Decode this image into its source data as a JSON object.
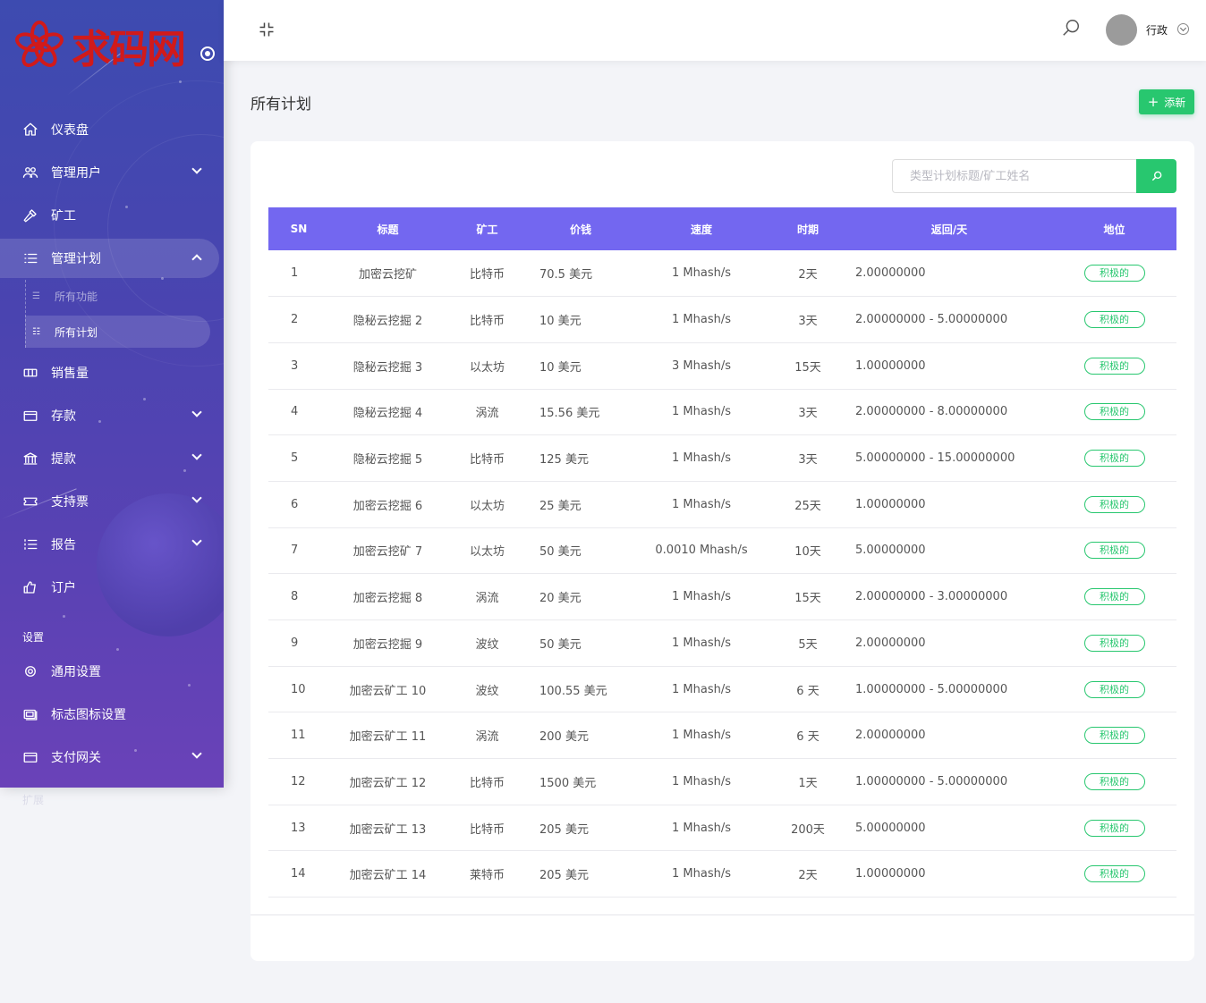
{
  "brand": {
    "logo_text": "求码网"
  },
  "sidebar": {
    "items": [
      {
        "label": "仪表盘",
        "icon": "home-icon"
      },
      {
        "label": "管理用户",
        "icon": "users-icon"
      },
      {
        "label": "矿工",
        "icon": "hammer-icon"
      },
      {
        "label": "管理计划",
        "icon": "list-icon"
      },
      {
        "label": "销售量",
        "icon": "ticket-icon"
      },
      {
        "label": "存款",
        "icon": "card-icon"
      },
      {
        "label": "提款",
        "icon": "bank-icon"
      },
      {
        "label": "支持票",
        "icon": "support-ticket-icon"
      },
      {
        "label": "报告",
        "icon": "report-list-icon"
      },
      {
        "label": "订户",
        "icon": "thumbs-up-icon"
      }
    ],
    "sub_items": [
      {
        "label": "所有功能"
      },
      {
        "label": "所有计划"
      }
    ],
    "section_title": "设置",
    "settings_items": [
      {
        "label": "通用设置",
        "icon": "gear-icon"
      },
      {
        "label": "标志图标设置",
        "icon": "images-icon"
      },
      {
        "label": "支付网关",
        "icon": "card-icon"
      }
    ],
    "ghost_label": "扩展"
  },
  "header": {
    "user_name": "行政"
  },
  "page": {
    "title": "所有计划",
    "add_button": "添新"
  },
  "search": {
    "placeholder": "类型计划标题/矿工姓名"
  },
  "colors": {
    "accent": "#7367f0",
    "success": "#28c76f",
    "sidebar": "#4a44b0"
  },
  "table": {
    "headers": [
      "SN",
      "标题",
      "矿工",
      "价钱",
      "速度",
      "时期",
      "返回/天",
      "地位"
    ],
    "rows": [
      [
        "1",
        "加密云挖矿",
        "比特币",
        "70.5 美元",
        "1 Mhash/s",
        "2天",
        "2.00000000",
        "积极的"
      ],
      [
        "2",
        "隐秘云挖掘 2",
        "比特币",
        "10 美元",
        "1 Mhash/s",
        "3天",
        "2.00000000 - 5.00000000",
        "积极的"
      ],
      [
        "3",
        "隐秘云挖掘 3",
        "以太坊",
        "10 美元",
        "3 Mhash/s",
        "15天",
        "1.00000000",
        "积极的"
      ],
      [
        "4",
        "隐秘云挖掘 4",
        "涡流",
        "15.56 美元",
        "1 Mhash/s",
        "3天",
        "2.00000000 - 8.00000000",
        "积极的"
      ],
      [
        "5",
        "隐秘云挖掘 5",
        "比特币",
        "125 美元",
        "1 Mhash/s",
        "3天",
        "5.00000000 - 15.00000000",
        "积极的"
      ],
      [
        "6",
        "加密云挖掘 6",
        "以太坊",
        "25 美元",
        "1 Mhash/s",
        "25天",
        "1.00000000",
        "积极的"
      ],
      [
        "7",
        "加密云挖矿 7",
        "以太坊",
        "50 美元",
        "0.0010 Mhash/s",
        "10天",
        "5.00000000",
        "积极的"
      ],
      [
        "8",
        "加密云挖掘 8",
        "涡流",
        "20 美元",
        "1 Mhash/s",
        "15天",
        "2.00000000 - 3.00000000",
        "积极的"
      ],
      [
        "9",
        "加密云挖掘 9",
        "波纹",
        "50 美元",
        "1 Mhash/s",
        "5天",
        "2.00000000",
        "积极的"
      ],
      [
        "10",
        "加密云矿工 10",
        "波纹",
        "100.55 美元",
        "1 Mhash/s",
        "6 天",
        "1.00000000 - 5.00000000",
        "积极的"
      ],
      [
        "11",
        "加密云矿工 11",
        "涡流",
        "200 美元",
        "1 Mhash/s",
        "6 天",
        "2.00000000",
        "积极的"
      ],
      [
        "12",
        "加密云矿工 12",
        "比特币",
        "1500 美元",
        "1 Mhash/s",
        "1天",
        "1.00000000 - 5.00000000",
        "积极的"
      ],
      [
        "13",
        "加密云矿工 13",
        "比特币",
        "205 美元",
        "1 Mhash/s",
        "200天",
        "5.00000000",
        "积极的"
      ],
      [
        "14",
        "加密云矿工 14",
        "莱特币",
        "205 美元",
        "1 Mhash/s",
        "2天",
        "1.00000000",
        "积极的"
      ]
    ]
  }
}
